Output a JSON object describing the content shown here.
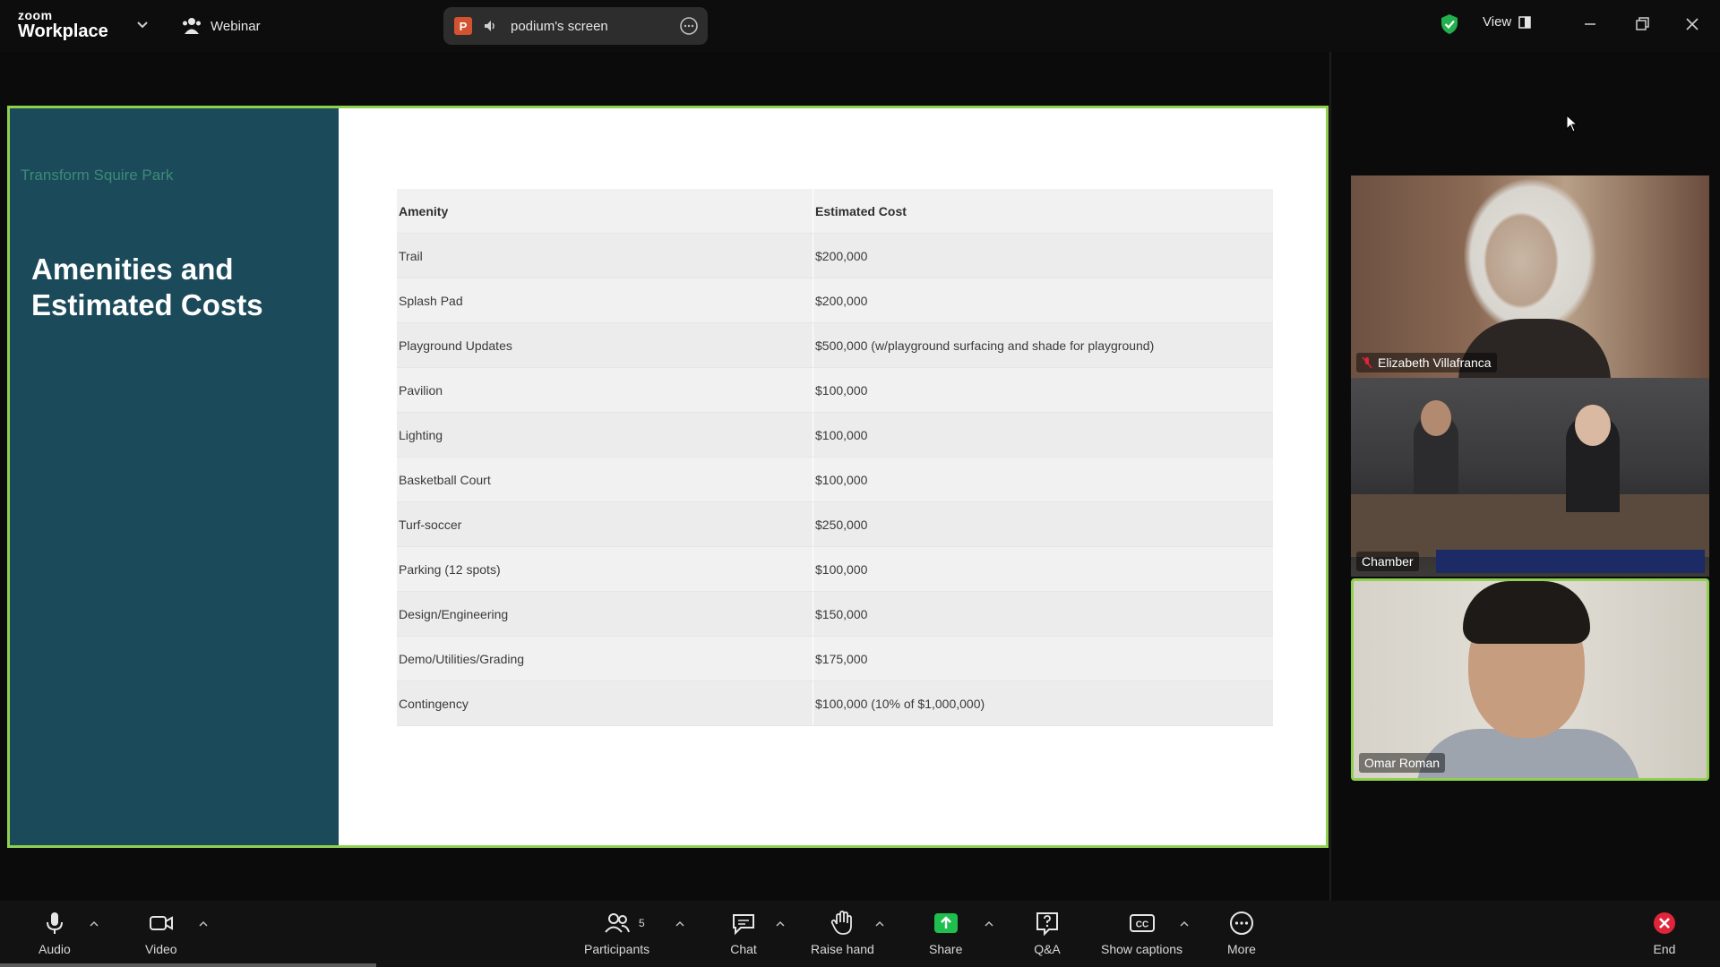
{
  "titlebar": {
    "brand_top": "zoom",
    "brand_bottom": "Workplace",
    "webinar_label": "Webinar",
    "share_label": "podium's screen",
    "share_app_letter": "P",
    "view_label": "View"
  },
  "slide": {
    "kicker": "Transform Squire Park",
    "title": "Amenities and Estimated Costs",
    "table_headers": [
      "Amenity",
      "Estimated Cost"
    ],
    "rows": [
      {
        "amenity": "Trail",
        "cost": "$200,000"
      },
      {
        "amenity": "Splash Pad",
        "cost": "$200,000"
      },
      {
        "amenity": "Playground Updates",
        "cost": "$500,000 (w/playground surfacing and shade for playground)"
      },
      {
        "amenity": "Pavilion",
        "cost": "$100,000"
      },
      {
        "amenity": "Lighting",
        "cost": "$100,000"
      },
      {
        "amenity": "Basketball Court",
        "cost": "$100,000"
      },
      {
        "amenity": "Turf-soccer",
        "cost": "$250,000"
      },
      {
        "amenity": "Parking (12 spots)",
        "cost": "$100,000"
      },
      {
        "amenity": "Design/Engineering",
        "cost": "$150,000"
      },
      {
        "amenity": "Demo/Utilities/Grading",
        "cost": "$175,000"
      },
      {
        "amenity": "Contingency",
        "cost": "$100,000 (10% of $1,000,000)"
      }
    ]
  },
  "participants_video": [
    {
      "name": "Elizabeth Villafranca",
      "muted": true
    },
    {
      "name": "Chamber",
      "muted": false
    },
    {
      "name": "Omar Roman",
      "muted": false,
      "active_speaker": true
    }
  ],
  "toolbar": {
    "audio": "Audio",
    "video": "Video",
    "participants": "Participants",
    "participants_count": "5",
    "chat": "Chat",
    "raise_hand": "Raise hand",
    "share": "Share",
    "qa": "Q&A",
    "captions": "Show captions",
    "more": "More",
    "end": "End"
  },
  "colors": {
    "accent_green": "#8fd14f",
    "slide_panel": "#1b4a5a",
    "share_green": "#1fbf4f",
    "end_red": "#e0243a"
  }
}
